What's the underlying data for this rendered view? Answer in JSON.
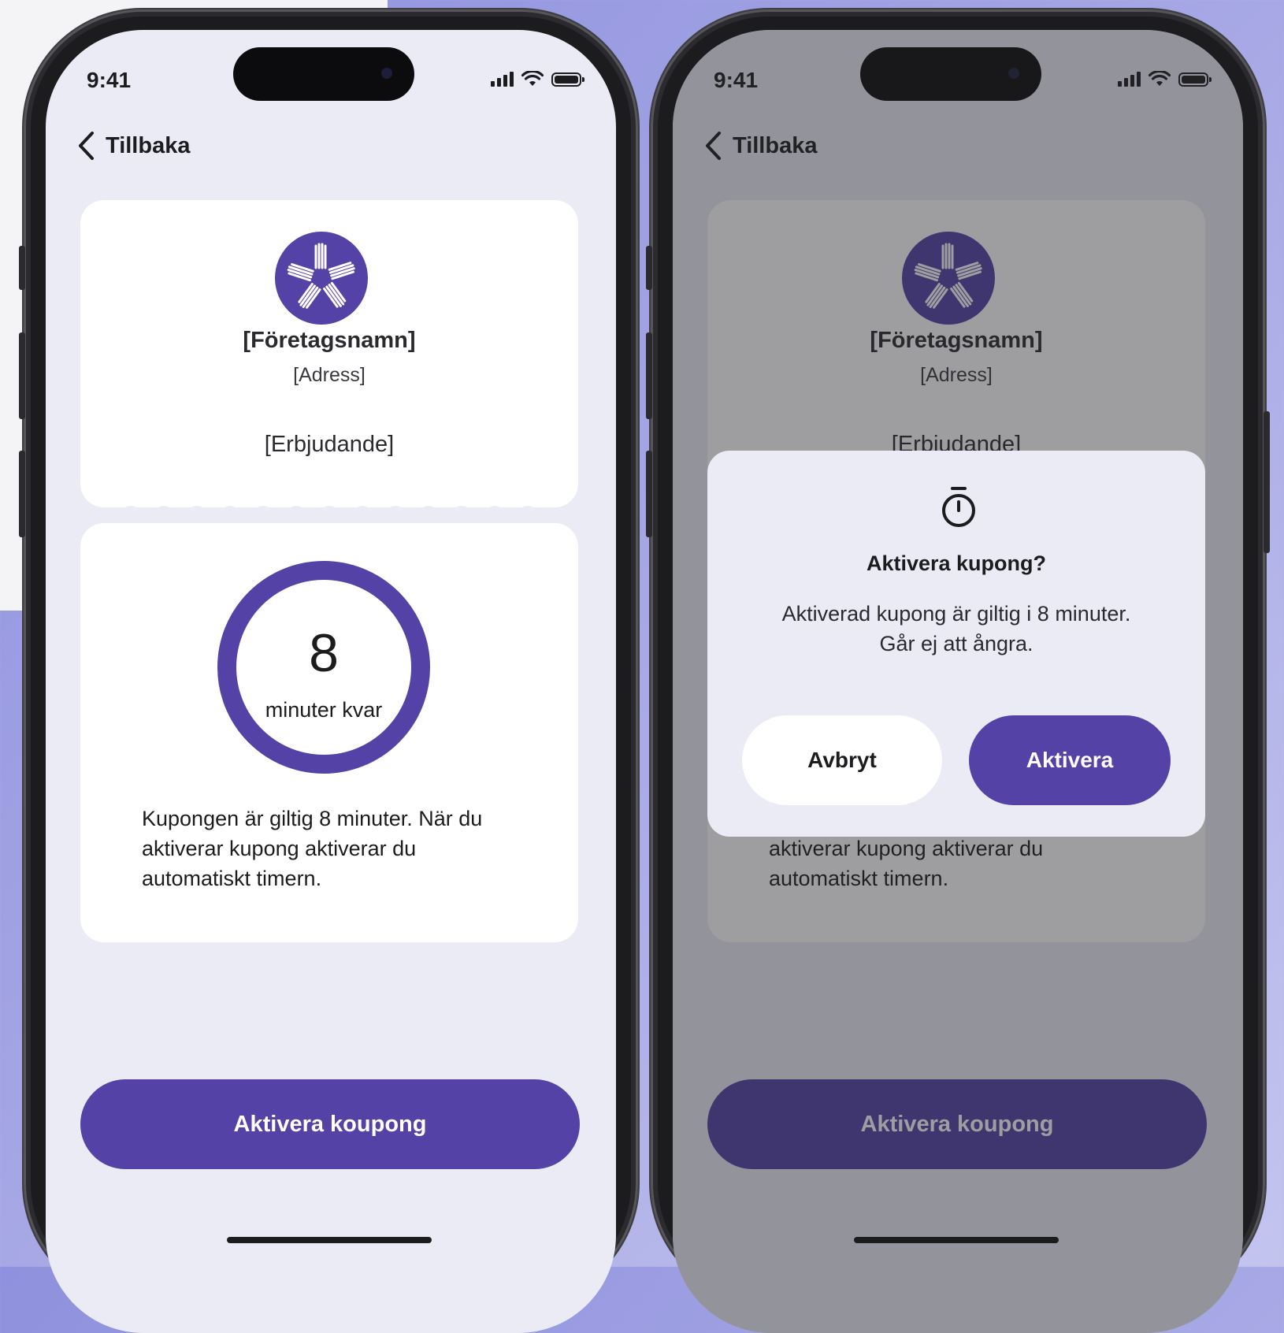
{
  "status": {
    "time": "9:41"
  },
  "nav": {
    "back_label": "Tillbaka"
  },
  "coupon": {
    "company": "[Företagsnamn]",
    "address": "[Adress]",
    "offer": "[Erbjudande]",
    "timer_value": "8",
    "timer_label": "minuter kvar",
    "description": "Kupongen är giltig 8 minuter. När du aktiverar kupong aktiverar du automatiskt timern."
  },
  "cta": {
    "label": "Aktivera koupong"
  },
  "dialog": {
    "icon": "stopwatch-icon",
    "title": "Aktivera kupong?",
    "message_line1": "Aktiverad kupong är giltig i 8 minuter.",
    "message_line2": "Går ej att ångra.",
    "cancel_label": "Avbryt",
    "confirm_label": "Aktivera"
  },
  "colors": {
    "accent": "#5442a6",
    "screen_bg": "#ebebf6",
    "card_bg": "#ffffff"
  }
}
